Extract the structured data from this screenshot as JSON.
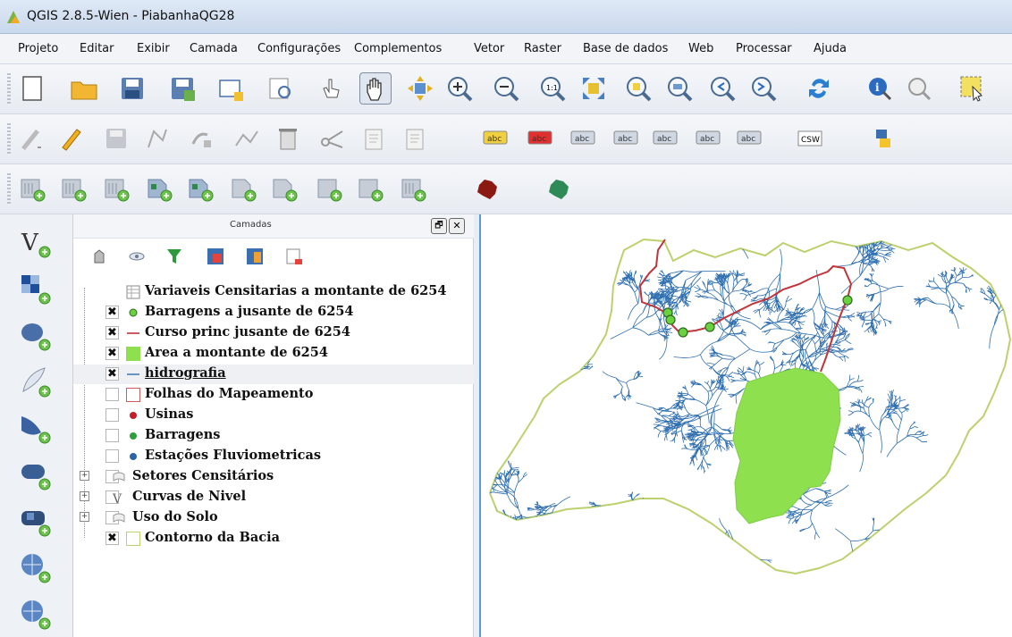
{
  "window": {
    "title": "QGIS 2.8.5-Wien - PiabanhaQG28"
  },
  "menubar": {
    "items": [
      "Projeto",
      "Editar",
      "Exibir",
      "Camada",
      "Configurações",
      "Complementos",
      "Vetor",
      "Raster",
      "Base de dados",
      "Web",
      "Processar",
      "Ajuda"
    ]
  },
  "toolbars": {
    "row1": [
      "new-project-icon",
      "open-folder-icon",
      "save-icon",
      "save-as-icon",
      "new-print-composer-icon",
      "composer-manager-icon",
      "touch-zoom-icon",
      "pan-hand-icon",
      "pan-to-selection-icon",
      "zoom-in-icon",
      "zoom-out-icon",
      "zoom-native-icon",
      "zoom-full-icon",
      "zoom-to-selection-icon",
      "zoom-to-layer-icon",
      "zoom-last-icon",
      "zoom-next-icon",
      "refresh-icon",
      "identify-icon",
      "measure-icon",
      "select-features-icon"
    ],
    "row2": [
      "current-edits-icon",
      "toggle-editing-icon",
      "save-edits-icon",
      "add-feature-icon",
      "move-feature-icon",
      "node-tool-icon",
      "delete-selected-icon",
      "cut-features-icon",
      "copy-features-icon",
      "paste-features-icon",
      "label-icon",
      "label-pin-icon",
      "label-show-hide-icon",
      "label-move-icon",
      "label-rotate-icon",
      "label-change-icon",
      "label-properties-icon",
      "csw-icon",
      "python-icon"
    ],
    "row3": [
      "add-vector-db-icon",
      "add-spatialite-icon",
      "add-mssql-icon",
      "add-oracle-icon",
      "add-wms-icon",
      "add-wcs-icon",
      "add-wfs-icon",
      "add-delimited-text-icon",
      "new-shapefile-icon",
      "new-spatialite-icon",
      "map-plugin-red-icon",
      "map-plugin-green-icon"
    ]
  },
  "left_toolbar": [
    "add-vector-layer-icon",
    "add-raster-layer-icon",
    "add-postgis-icon",
    "add-spatialite-layer-icon",
    "add-mssql-layer-icon",
    "add-oracle-layer-icon",
    "add-wms-layer-icon",
    "add-wcs-layer-icon",
    "add-wfs-layer-icon"
  ],
  "layers_panel": {
    "title": "Camadas",
    "float_label": "🗗",
    "close_label": "✕",
    "check_mark": "✖",
    "layers": [
      {
        "label": "Variaveis Censitarias a montante de 6254",
        "checked": null,
        "symbol": "table-icon",
        "expand": ""
      },
      {
        "label": "Barragens a jusante de 6254",
        "checked": true,
        "symbol": "point-lightgreen",
        "expand": ""
      },
      {
        "label": "Curso princ jusante de 6254",
        "checked": true,
        "symbol": "line-red",
        "expand": ""
      },
      {
        "label": "Area a montante de 6254",
        "checked": true,
        "symbol": "polygon-green",
        "expand": ""
      },
      {
        "label": "hidrografia",
        "checked": true,
        "symbol": "line-blue",
        "expand": ""
      },
      {
        "label": "Folhas do Mapeamento",
        "checked": false,
        "symbol": "polygon-outline-red",
        "expand": ""
      },
      {
        "label": "Usinas",
        "checked": false,
        "symbol": "point-red",
        "expand": ""
      },
      {
        "label": "Barragens",
        "checked": false,
        "symbol": "point-green",
        "expand": ""
      },
      {
        "label": "Estações Fluviometricas",
        "checked": false,
        "symbol": "point-blue",
        "expand": ""
      },
      {
        "label": "Setores Censitários",
        "checked": false,
        "symbol": "raster-layer-icon",
        "expand": "+"
      },
      {
        "label": "Curvas de Nivel",
        "checked": false,
        "symbol": "vector-line-icon",
        "expand": "+"
      },
      {
        "label": "Uso do Solo",
        "checked": false,
        "symbol": "raster-layer-icon",
        "expand": "+"
      },
      {
        "label": "Contorno da Bacia",
        "checked": true,
        "symbol": "polygon-outline-green",
        "expand": ""
      }
    ]
  },
  "colors": {
    "basin_fill": "#ffffff",
    "basin_outline": "#bcd16e",
    "rivers": "#2f6fb0",
    "area_fill": "#8fe04f",
    "main_course": "#c0343a",
    "dam_points": "#6ad13f"
  }
}
